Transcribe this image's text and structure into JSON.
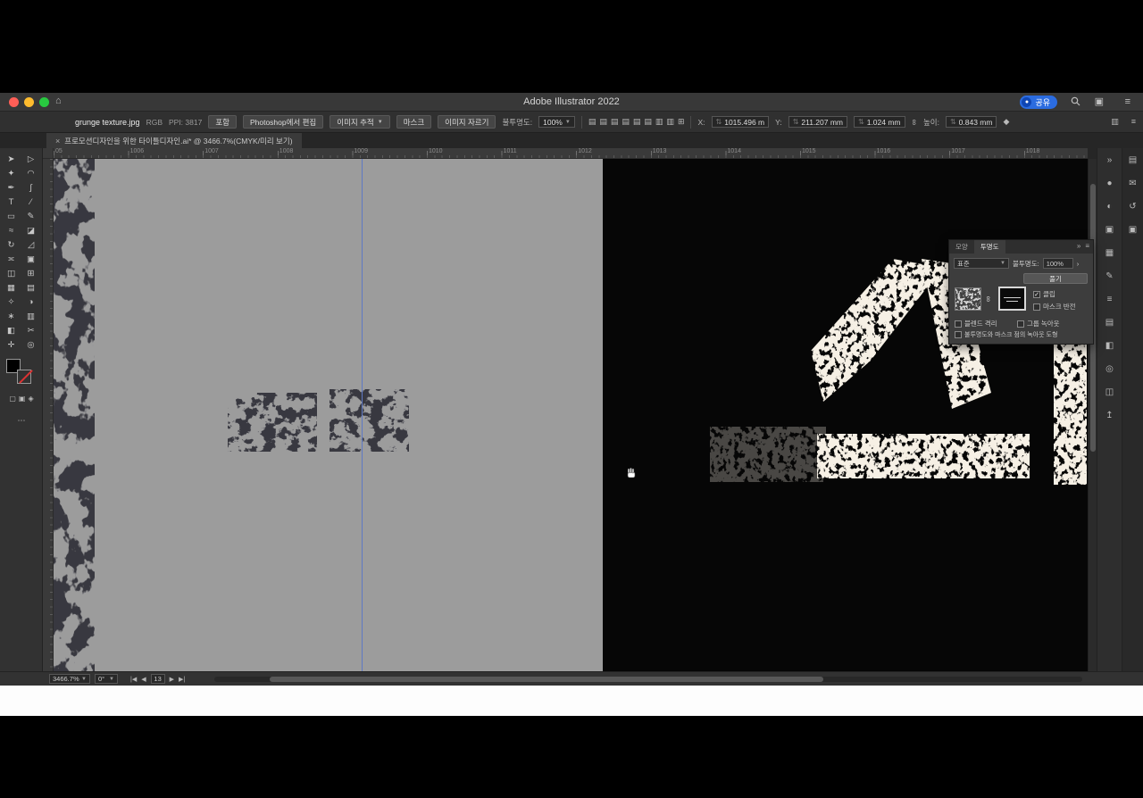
{
  "titlebar": {
    "title": "Adobe Illustrator 2022",
    "share_label": "공유"
  },
  "controlbar": {
    "filename": "grunge texture.jpg",
    "colorspace": "RGB",
    "ppi": "PPI: 3817",
    "embed_button": "포함",
    "edit_in_photoshop_button": "Photoshop에서 편집",
    "image_trace_button": "이미지 추적",
    "mask_button": "마스크",
    "crop_image_button": "이미지 자르기",
    "opacity_label": "불투명도:",
    "opacity_value": "100%",
    "x_label": "X:",
    "x_value": "1015.496 m",
    "y_label": "Y:",
    "y_value": "211.207 mm",
    "w_value": "1.024 mm",
    "h_label": "높이:",
    "h_value": "0.843 mm"
  },
  "doc_tab": {
    "close_glyph": "×",
    "title": "프로모션디자인을 위한 타이틀디자인.ai* @ 3466.7%(CMYK/미리 보기)"
  },
  "ruler": {
    "numbers": [
      "05",
      "1006",
      "1007",
      "1008",
      "1009",
      "1010",
      "1011",
      "1012",
      "1013",
      "1014",
      "1015",
      "1016",
      "1017",
      "1018"
    ]
  },
  "tools": [
    {
      "name": "selection-tool",
      "glyph": "➤"
    },
    {
      "name": "direct-selection-tool",
      "glyph": "▷"
    },
    {
      "name": "magic-wand-tool",
      "glyph": "✦"
    },
    {
      "name": "lasso-tool",
      "glyph": "◠"
    },
    {
      "name": "pen-tool",
      "glyph": "✒"
    },
    {
      "name": "curvature-tool",
      "glyph": "∫"
    },
    {
      "name": "type-tool",
      "glyph": "T"
    },
    {
      "name": "line-segment-tool",
      "glyph": "∕"
    },
    {
      "name": "rectangle-tool",
      "glyph": "▭"
    },
    {
      "name": "paintbrush-tool",
      "glyph": "✎"
    },
    {
      "name": "shaper-tool",
      "glyph": "≈"
    },
    {
      "name": "eraser-tool",
      "glyph": "◪"
    },
    {
      "name": "rotate-tool",
      "glyph": "↻"
    },
    {
      "name": "scale-tool",
      "glyph": "◿"
    },
    {
      "name": "width-tool",
      "glyph": "≍"
    },
    {
      "name": "free-transform-tool",
      "glyph": "▣"
    },
    {
      "name": "shape-builder-tool",
      "glyph": "◫"
    },
    {
      "name": "perspective-grid-tool",
      "glyph": "⊞"
    },
    {
      "name": "mesh-tool",
      "glyph": "▦"
    },
    {
      "name": "gradient-tool",
      "glyph": "▤"
    },
    {
      "name": "eyedropper-tool",
      "glyph": "✧"
    },
    {
      "name": "blend-tool",
      "glyph": "◑"
    },
    {
      "name": "symbol-sprayer-tool",
      "glyph": "∗"
    },
    {
      "name": "column-graph-tool",
      "glyph": "▥"
    },
    {
      "name": "artboard-tool",
      "glyph": "◧"
    },
    {
      "name": "slice-tool",
      "glyph": "✂"
    },
    {
      "name": "hand-tool",
      "glyph": "✛"
    },
    {
      "name": "zoom-tool",
      "glyph": "◎"
    }
  ],
  "toolbar_modes": [
    {
      "name": "draw-normal-icon",
      "glyph": "▢"
    },
    {
      "name": "draw-behind-icon",
      "glyph": "▣"
    },
    {
      "name": "draw-inside-icon",
      "glyph": "◈"
    }
  ],
  "dock_inner": [
    {
      "name": "collapse-panels-icon",
      "glyph": "»"
    },
    {
      "name": "color-panel-icon",
      "glyph": "●"
    },
    {
      "name": "color-guide-icon",
      "glyph": "◐"
    },
    {
      "name": "libraries-icon",
      "glyph": "▣"
    },
    {
      "name": "swatches-icon",
      "glyph": "▦"
    },
    {
      "name": "brushes-icon",
      "glyph": "✎"
    },
    {
      "name": "stroke-panel-icon",
      "glyph": "≡"
    },
    {
      "name": "gradient-panel-icon",
      "glyph": "▤"
    },
    {
      "name": "transparency-panel-icon",
      "glyph": "◧"
    },
    {
      "name": "appearance-panel-icon",
      "glyph": "◎"
    },
    {
      "name": "layers-panel-icon",
      "glyph": "◫"
    },
    {
      "name": "asset-export-icon",
      "glyph": "↥"
    }
  ],
  "dock_outer": [
    {
      "name": "properties-panel-icon",
      "glyph": "▤"
    },
    {
      "name": "comments-icon",
      "glyph": "✉"
    },
    {
      "name": "version-history-icon",
      "glyph": "↺"
    },
    {
      "name": "libraries-panel-icon",
      "glyph": "▣"
    }
  ],
  "align_icons": [
    {
      "name": "align-left-icon",
      "glyph": "▤"
    },
    {
      "name": "align-center-h-icon",
      "glyph": "▤"
    },
    {
      "name": "align-right-icon",
      "glyph": "▤"
    },
    {
      "name": "align-top-icon",
      "glyph": "▤"
    },
    {
      "name": "align-middle-v-icon",
      "glyph": "▤"
    },
    {
      "name": "align-bottom-icon",
      "glyph": "▤"
    },
    {
      "name": "distribute-h-icon",
      "glyph": "▥"
    },
    {
      "name": "distribute-v-icon",
      "glyph": "▥"
    },
    {
      "name": "align-options-icon",
      "glyph": "⊞"
    }
  ],
  "transparency_panel": {
    "tab_appearance": "모양",
    "tab_transparency": "투명도",
    "blend_mode": "표준",
    "opacity_label": "불투명도:",
    "opacity_value": "100%",
    "release_button": "풀기",
    "clip_label": "클립",
    "invert_mask_label": "마스크 반전",
    "isolate_blending_label": "블렌드 격리",
    "knockout_group_label": "그룹 녹아웃",
    "opacity_mask_define_label": "불투명도와 마스크 점의 녹아웃 도형"
  },
  "statusbar": {
    "zoom": "3466.7%",
    "rotation": "0°",
    "artboard_number": "13",
    "nav_first": "|◀",
    "nav_prev": "◀",
    "nav_next": "▶",
    "nav_last": "▶|"
  },
  "colors": {
    "accent_blue": "#2b6ce0",
    "artboard_gray": "#9c9c9c",
    "canvas_black": "#060606",
    "guide_blue": "#5e79c4"
  }
}
